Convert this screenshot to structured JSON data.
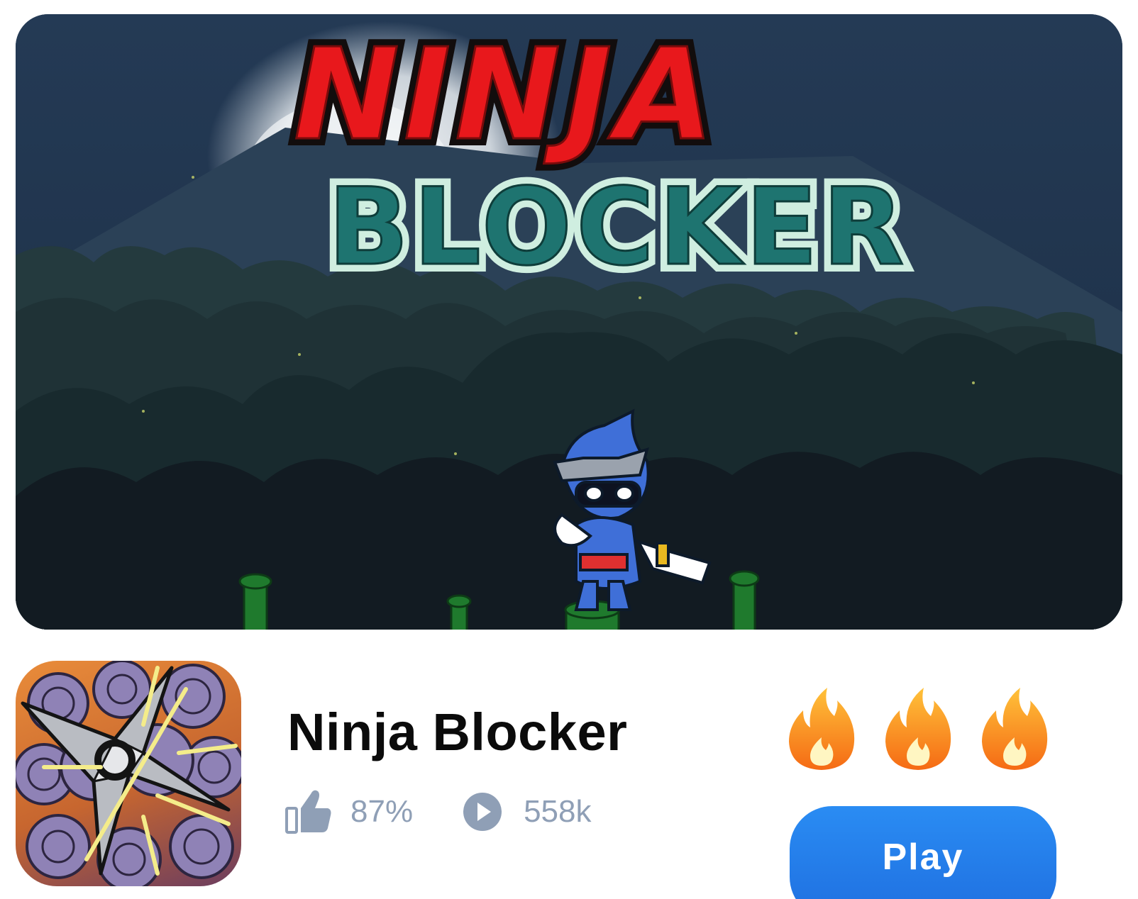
{
  "banner": {
    "logo_line1": "NINJA",
    "logo_line2": "BLOCKER"
  },
  "game": {
    "title": "Ninja Blocker",
    "rating": "87%",
    "plays": "558k",
    "hotness_level": 3,
    "play_label": "Play"
  },
  "icons": {
    "like": "thumbs-up-icon",
    "plays": "play-circle-icon",
    "hot": "fire-icon",
    "app": "shuriken-icon"
  },
  "colors": {
    "logo_red": "#e8181c",
    "logo_teal": "#1e7470",
    "stat_gray": "#8f9fb6",
    "play_blue": "#2a8cf3",
    "fire_orange": "#fb7d1b",
    "fire_yellow": "#ffd43b"
  }
}
